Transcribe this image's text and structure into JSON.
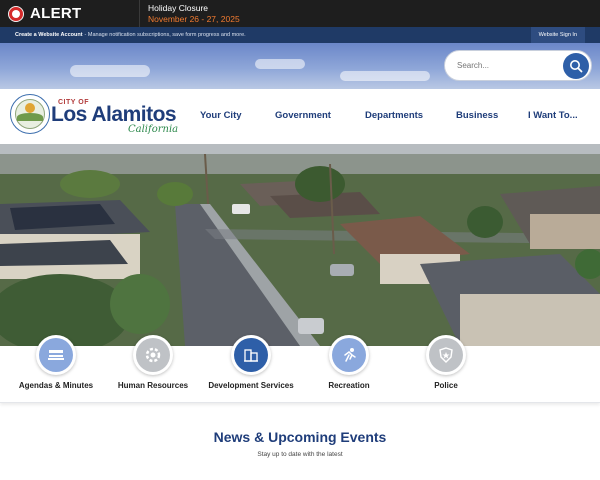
{
  "alert": {
    "label": "ALERT",
    "title": "Holiday Closure",
    "date": "November 26 - 27, 2025"
  },
  "account_bar": {
    "create_link": "Create a Website Account",
    "note": "- Manage notification subscriptions, save form progress and more.",
    "signin_label": "Website Sign In"
  },
  "search": {
    "placeholder": "Search..."
  },
  "logo": {
    "city_of": "CITY OF",
    "name": "Los Alamitos",
    "state": "California"
  },
  "nav": {
    "items": [
      "Your City",
      "Government",
      "Departments",
      "Business",
      "I Want To..."
    ]
  },
  "quick_links": [
    {
      "label": "Agendas & Minutes",
      "icon": "agenda-icon"
    },
    {
      "label": "Human Resources",
      "icon": "gear-icon"
    },
    {
      "label": "Development Services",
      "icon": "building-icon"
    },
    {
      "label": "Recreation",
      "icon": "runner-icon"
    },
    {
      "label": "Police",
      "icon": "police-badge-icon"
    }
  ],
  "news": {
    "title": "News & Upcoming Events",
    "subtitle": "Stay up to date with the latest"
  },
  "colors": {
    "brand_navy": "#1f3d7a",
    "alert_red": "#d42a2a",
    "alert_date": "#f07a30",
    "account_bar": "#1f3a66",
    "search_button": "#2e5fa8"
  }
}
